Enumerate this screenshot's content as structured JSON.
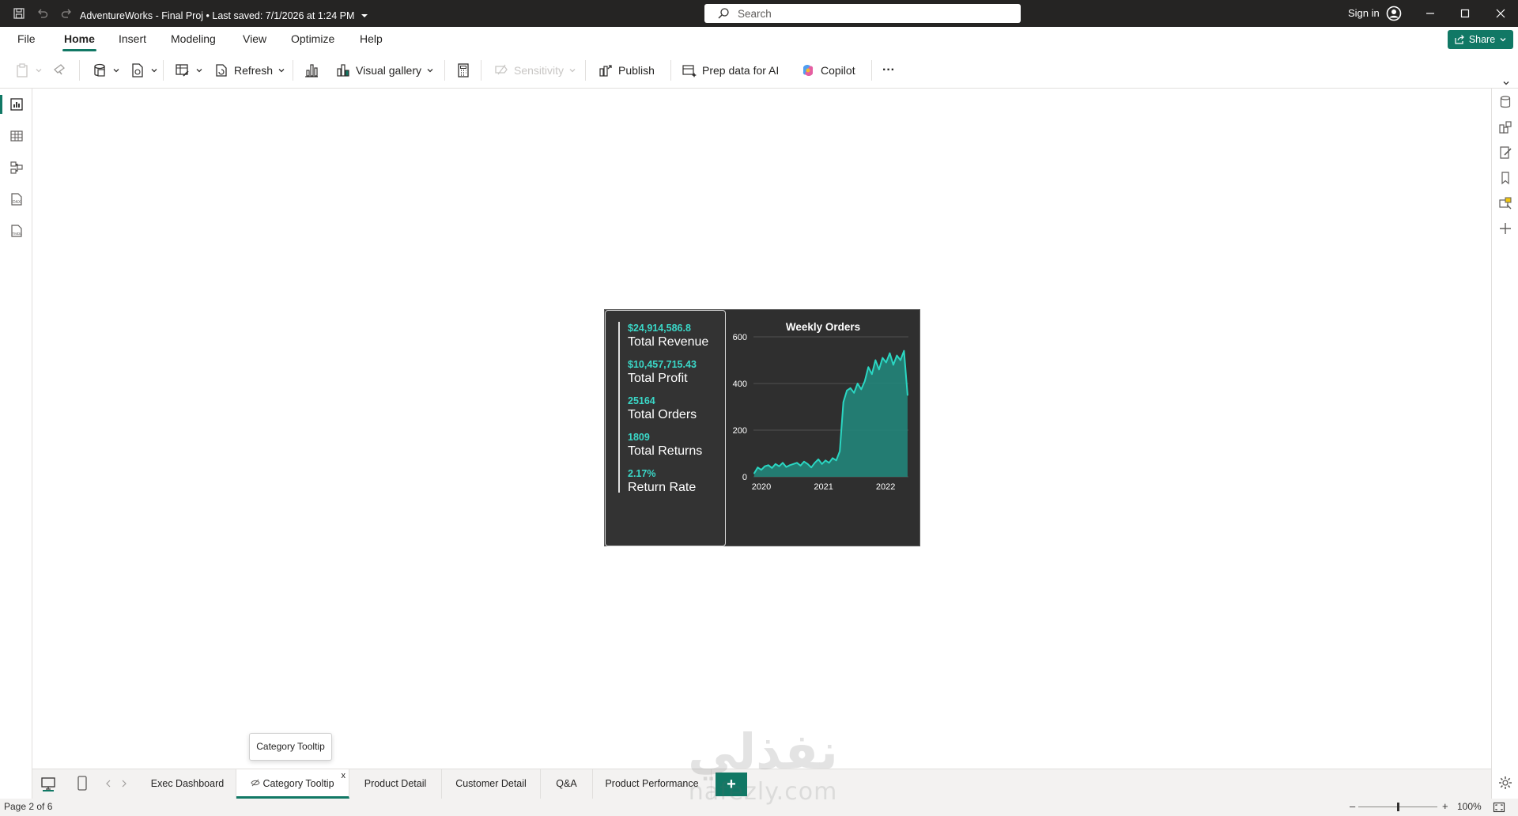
{
  "titlebar": {
    "doc_title": "AdventureWorks - Final Proj • Last saved: 7/1/2026 at 1:24 PM",
    "search_placeholder": "Search",
    "signin_label": "Sign in"
  },
  "menu": {
    "tabs": [
      "File",
      "Home",
      "Insert",
      "Modeling",
      "View",
      "Optimize",
      "Help"
    ],
    "active_tab": "Home",
    "share_label": "Share"
  },
  "toolbar": {
    "refresh_label": "Refresh",
    "visual_gallery_label": "Visual gallery",
    "sensitivity_label": "Sensitivity",
    "publish_label": "Publish",
    "prep_data_label": "Prep data for AI",
    "copilot_label": "Copilot",
    "more_label": "···"
  },
  "kpis": [
    {
      "value": "$24,914,586.8",
      "label": "Total Revenue"
    },
    {
      "value": "$10,457,715.43",
      "label": "Total Profit"
    },
    {
      "value": "25164",
      "label": "Total Orders"
    },
    {
      "value": "1809",
      "label": "Total Returns"
    },
    {
      "value": "2.17%",
      "label": "Return Rate"
    }
  ],
  "chart_data": {
    "type": "area",
    "title": "Weekly Orders",
    "xlabel": "",
    "ylabel": "",
    "x_ticks": [
      "2020",
      "2021",
      "2022"
    ],
    "y_ticks": [
      0,
      200,
      400,
      600
    ],
    "ylim": [
      0,
      600
    ],
    "xlim": [
      "2020-01-01",
      "2022-07-01"
    ],
    "grid": true,
    "color": "#2bd6c2",
    "fill_color": "#22857a",
    "x": [
      "2020-01-05",
      "2020-01-26",
      "2020-02-16",
      "2020-03-08",
      "2020-03-29",
      "2020-04-19",
      "2020-05-10",
      "2020-05-31",
      "2020-06-21",
      "2020-07-12",
      "2020-08-02",
      "2020-08-23",
      "2020-09-13",
      "2020-10-04",
      "2020-10-25",
      "2020-11-15",
      "2020-12-06",
      "2020-12-27",
      "2021-01-17",
      "2021-02-07",
      "2021-02-28",
      "2021-03-21",
      "2021-04-11",
      "2021-05-02",
      "2021-05-23",
      "2021-06-13",
      "2021-07-04",
      "2021-07-25",
      "2021-08-15",
      "2021-09-05",
      "2021-09-26",
      "2021-10-17",
      "2021-11-07",
      "2021-11-28",
      "2021-12-19",
      "2022-01-09",
      "2022-01-30",
      "2022-02-20",
      "2022-03-13",
      "2022-04-03",
      "2022-04-24",
      "2022-05-15",
      "2022-06-05",
      "2022-06-26"
    ],
    "values": [
      15,
      40,
      30,
      45,
      50,
      38,
      55,
      45,
      60,
      42,
      50,
      55,
      60,
      48,
      65,
      55,
      40,
      60,
      75,
      55,
      70,
      60,
      80,
      70,
      110,
      320,
      370,
      380,
      360,
      400,
      375,
      410,
      470,
      440,
      500,
      460,
      510,
      490,
      530,
      480,
      520,
      500,
      540,
      350
    ]
  },
  "pages": {
    "tabs": [
      "Exec Dashboard",
      "Category Tooltip",
      "Product Detail",
      "Customer Detail",
      "Q&A",
      "Product Performance"
    ],
    "active": "Category Tooltip",
    "hover_tooltip": "Category Tooltip",
    "close_glyph": "x",
    "add_glyph": "+"
  },
  "status": {
    "page_label": "Page 2 of 6",
    "zoom": "100%",
    "zoom_level": 0.5
  },
  "watermark": {
    "text_main": "نفذلي",
    "text_sub": "nafezly.com"
  }
}
